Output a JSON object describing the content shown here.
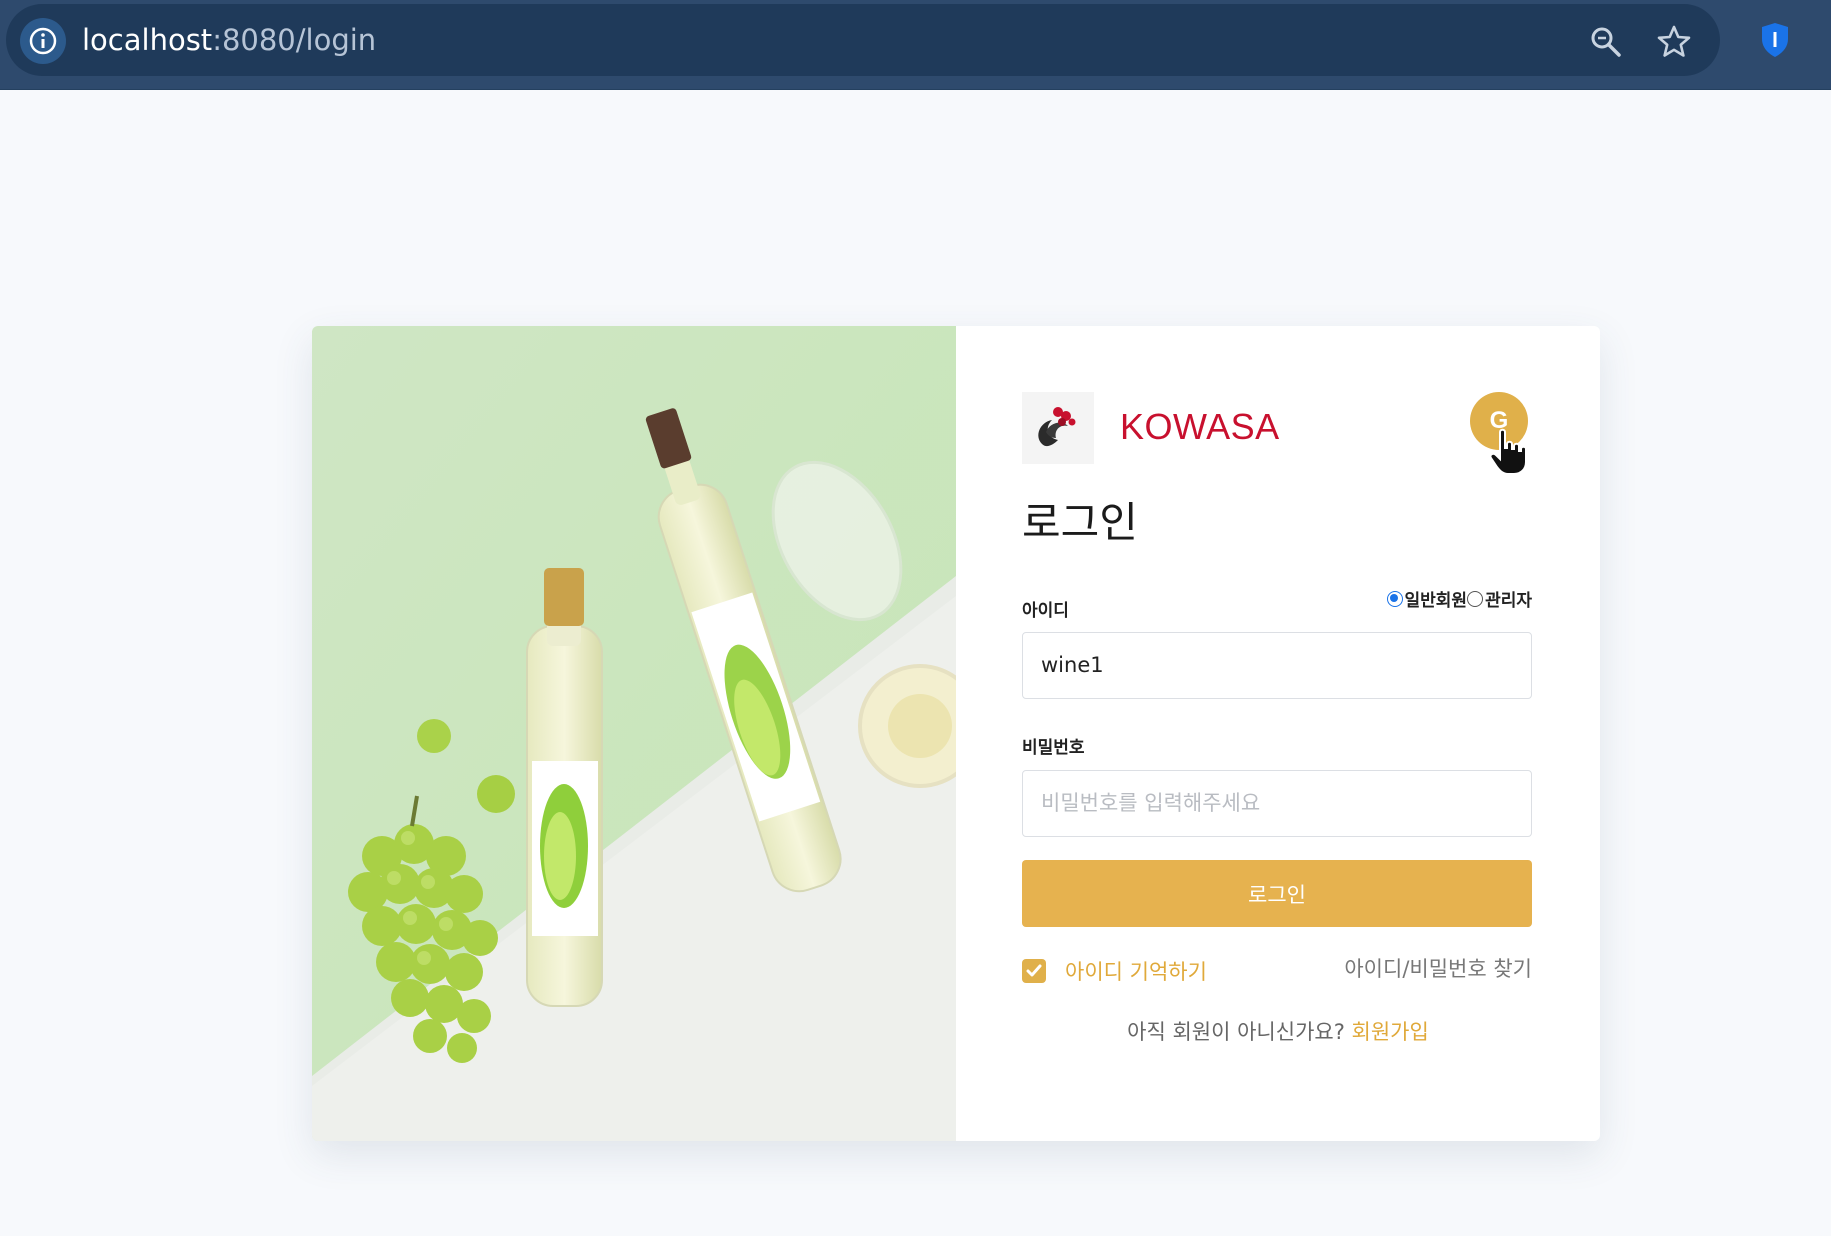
{
  "browser": {
    "url_host": "localhost",
    "url_rest": ":8080/login",
    "icons": [
      "info-icon",
      "zoom-icon",
      "bookmark-star-icon",
      "password-manager-shield-icon"
    ]
  },
  "brand": {
    "name": "KOWASA",
    "color": "#c8102e"
  },
  "google_button": {
    "label": "G"
  },
  "form": {
    "title": "로그인",
    "id_label": "아이디",
    "member_types": [
      "일반회원",
      "관리자"
    ],
    "selected_member_type": "일반회원",
    "id_value": "wine1",
    "password_label": "비밀번호",
    "password_placeholder": "비밀번호를 입력해주세요",
    "login_button": "로그인",
    "remember_label": "아이디 기억하기",
    "remember_checked": true,
    "find_link": "아이디/비밀번호 찾기",
    "signup_prompt": "아직 회원이 아니신가요?",
    "signup_link": "회원가입"
  },
  "colors": {
    "accent": "#e6b24f",
    "topbar": "#2e4a6d"
  }
}
